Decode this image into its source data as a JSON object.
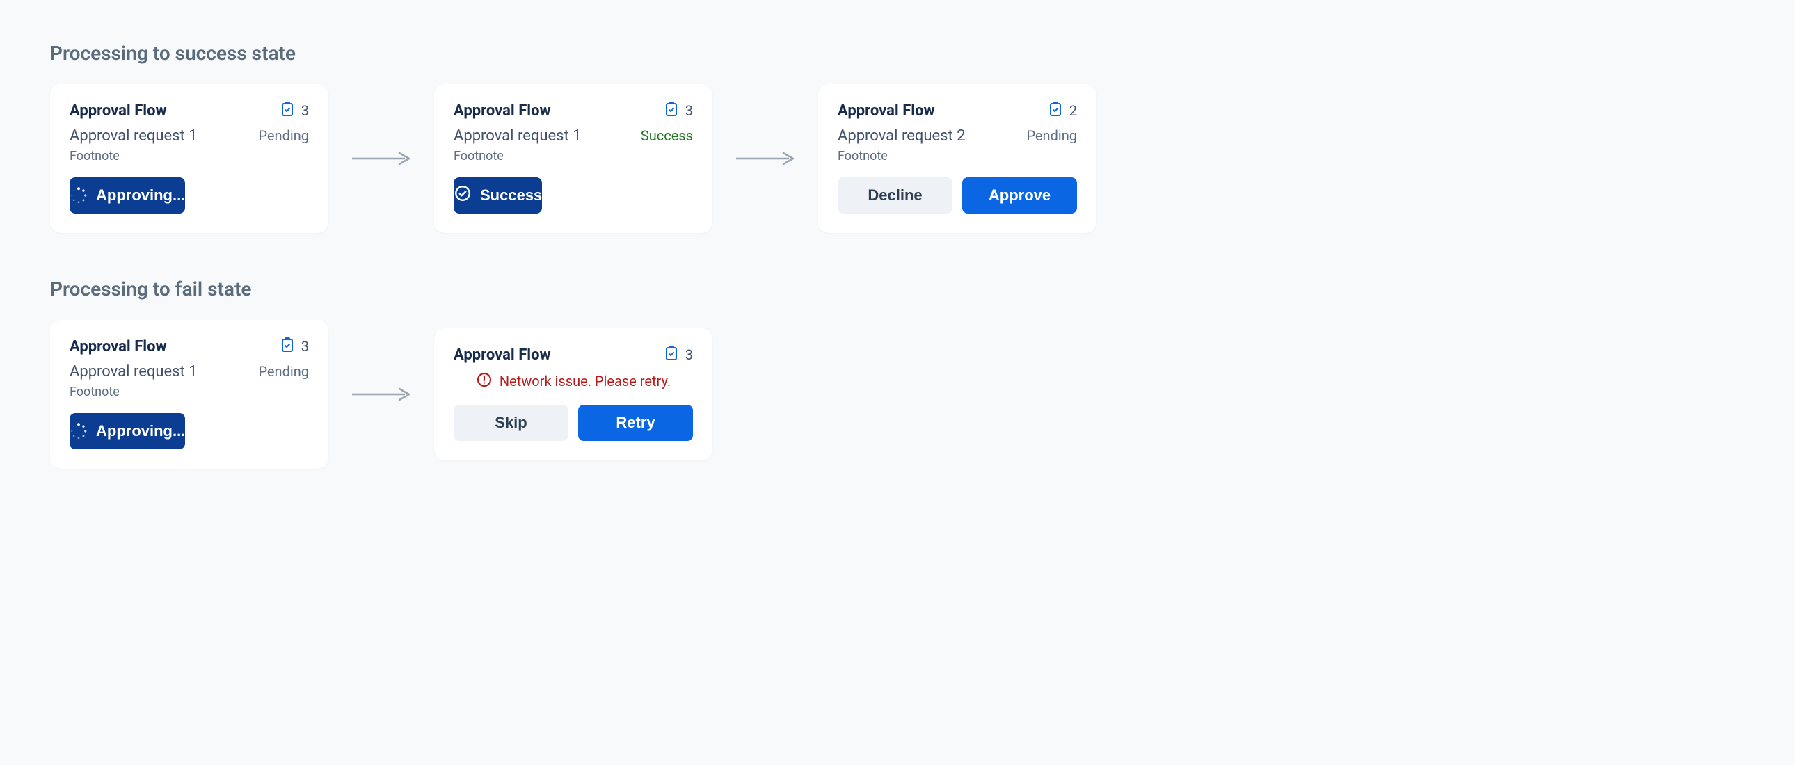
{
  "sections": {
    "success": {
      "title": "Processing to success state"
    },
    "fail": {
      "title": "Processing to fail state"
    }
  },
  "success_flow": {
    "card0": {
      "title": "Approval Flow",
      "count": "3",
      "subtitle": "Approval request 1",
      "status": "Pending",
      "footnote": "Footnote",
      "button_label": "Approving..."
    },
    "card1": {
      "title": "Approval Flow",
      "count": "3",
      "subtitle": "Approval request 1",
      "status": "Success",
      "footnote": "Footnote",
      "button_label": "Success"
    },
    "card2": {
      "title": "Approval Flow",
      "count": "2",
      "subtitle": "Approval request 2",
      "status": "Pending",
      "footnote": "Footnote",
      "decline_label": "Decline",
      "approve_label": "Approve"
    }
  },
  "fail_flow": {
    "card0": {
      "title": "Approval Flow",
      "count": "3",
      "subtitle": "Approval request 1",
      "status": "Pending",
      "footnote": "Footnote",
      "button_label": "Approving..."
    },
    "card1": {
      "title": "Approval Flow",
      "count": "3",
      "error_message": "Network issue. Please retry.",
      "skip_label": "Skip",
      "retry_label": "Retry"
    }
  }
}
